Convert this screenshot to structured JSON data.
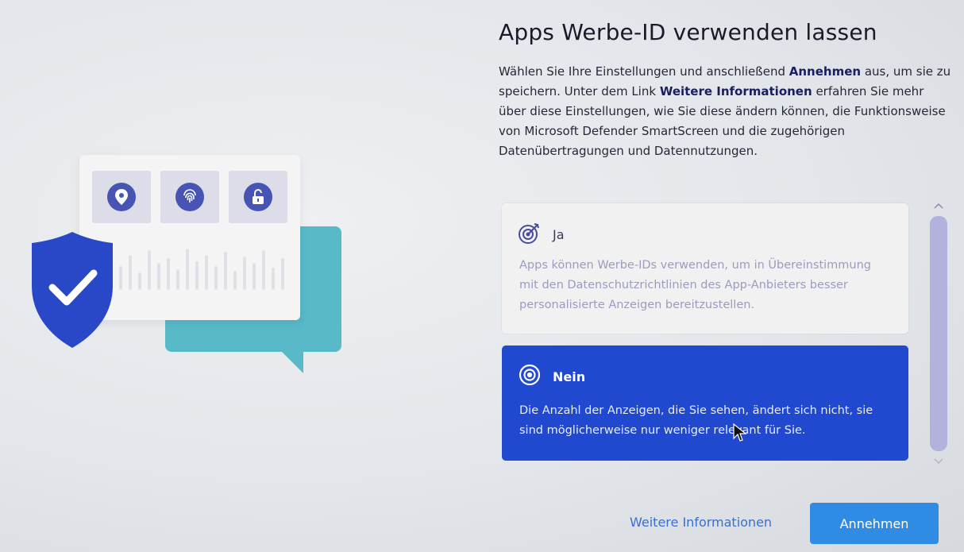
{
  "page": {
    "title": "Apps Werbe-ID verwenden lassen",
    "description": {
      "part1": "Wählen Sie Ihre Einstellungen und anschließend ",
      "strong1": "Annehmen",
      "part2": " aus, um sie zu speichern. Unter dem Link ",
      "strong2": "Weitere Informationen",
      "part3": " erfahren Sie mehr über diese Einstellungen, wie Sie diese ändern können, die Funktionsweise von Microsoft Defender SmartScreen und die zugehörigen Datenübertragungen und Datennutzungen."
    }
  },
  "options": {
    "yes": {
      "title": "Ja",
      "text": "Apps können Werbe-IDs verwenden, um in Übereinstimmung mit den Datenschutzrichtlinien des App-Anbieters besser personalisierte Anzeigen bereitzustellen.",
      "icon": "target-arrow-icon",
      "selected": false
    },
    "no": {
      "title": "Nein",
      "text": "Die Anzahl der Anzeigen, die Sie sehen, ändert sich nicht, sie sind möglicherweise nur weniger relevant für Sie.",
      "icon": "target-icon",
      "selected": true
    }
  },
  "footer": {
    "more_info_label": "Weitere Informationen",
    "accept_label": "Annehmen"
  },
  "colors": {
    "selected_card": "#2149cf",
    "accept_button": "#2f8be4",
    "link": "#3a6fd0",
    "shield": "#2948c8",
    "bubble": "#58b9c9"
  }
}
